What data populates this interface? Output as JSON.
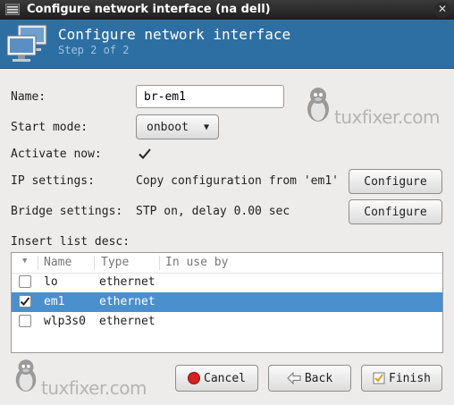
{
  "window": {
    "title": "Configure network interface (na dell)",
    "close_glyph": "✕"
  },
  "header": {
    "title": "Configure network interface",
    "subtitle": "Step 2 of 2",
    "icon": "network-computers-icon"
  },
  "form": {
    "name_label": "Name:",
    "name_value": "br-em1",
    "start_mode_label": "Start mode:",
    "start_mode_value": "onboot",
    "activate_now_label": "Activate now:",
    "activate_now_checked": true,
    "ip_settings_label": "IP settings:",
    "ip_settings_value": "Copy configuration from 'em1'",
    "ip_configure_label": "Configure",
    "bridge_settings_label": "Bridge settings:",
    "bridge_settings_value": "STP on, delay 0.00 sec",
    "bridge_configure_label": "Configure"
  },
  "list": {
    "label": "Insert list desc:",
    "columns": [
      "Name",
      "Type",
      "In use by"
    ],
    "rows": [
      {
        "name": "lo",
        "type": "ethernet",
        "in_use_by": "",
        "checked": false,
        "selected": false
      },
      {
        "name": "em1",
        "type": "ethernet",
        "in_use_by": "",
        "checked": true,
        "selected": true
      },
      {
        "name": "wlp3s0",
        "type": "ethernet",
        "in_use_by": "",
        "checked": false,
        "selected": false
      }
    ]
  },
  "watermark": {
    "text": "tuxfixer.com"
  },
  "buttons": {
    "cancel": "Cancel",
    "back": "Back",
    "finish": "Finish"
  },
  "colors": {
    "banner": "#2e6fa3",
    "selection": "#4a8fce",
    "cancel_red": "#d42020"
  }
}
